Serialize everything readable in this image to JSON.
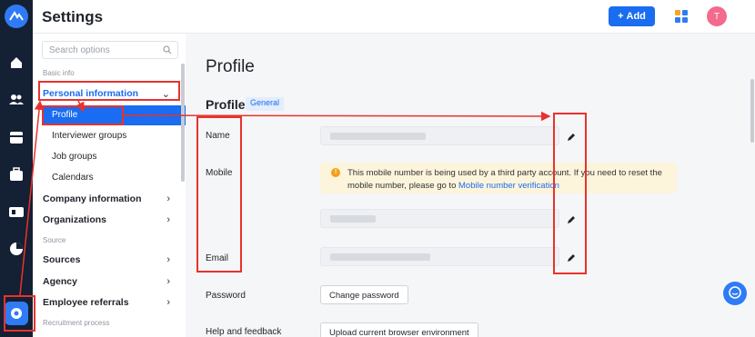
{
  "header": {
    "title": "Settings",
    "add_label": "Add",
    "avatar_initial": "T"
  },
  "sidebar": {
    "search_placeholder": "Search options",
    "section_basic": "Basic info",
    "personal_information": "Personal information",
    "sub_items": [
      "Profile",
      "Interviewer groups",
      "Job groups",
      "Calendars"
    ],
    "company_information": "Company information",
    "organizations": "Organizations",
    "section_source": "Source",
    "sources": "Sources",
    "agency": "Agency",
    "employee_referrals": "Employee referrals",
    "section_recruitment": "Recruitment process"
  },
  "main": {
    "page_title": "Profile",
    "section_title": "Profile",
    "section_tag": "General",
    "labels": {
      "name": "Name",
      "mobile": "Mobile",
      "email": "Email",
      "password": "Password",
      "help": "Help and feedback"
    },
    "notice": {
      "line1": "This mobile number is being used by a third party account. If you need to reset the",
      "line2_prefix": "mobile number, please go to",
      "link": "Mobile number verification"
    },
    "change_password": "Change password",
    "upload_env": "Upload current browser environment"
  },
  "colors": {
    "accent": "#1a6cf0",
    "rail": "#142033",
    "annotation": "#e8322d",
    "notice_bg": "#fdf4dc"
  },
  "icons": [
    "home-icon",
    "people-icon",
    "calendar-icon",
    "briefcase-icon",
    "id-card-icon",
    "chart-icon",
    "settings-icon",
    "search-icon",
    "pencil-icon",
    "chat-icon"
  ]
}
